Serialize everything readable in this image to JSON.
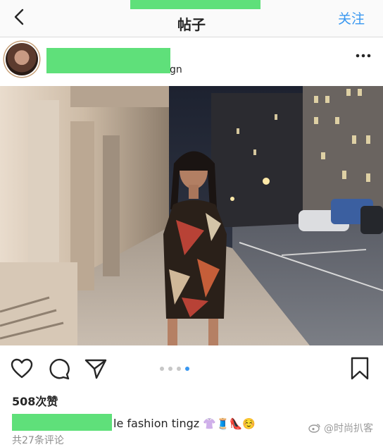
{
  "header": {
    "title": "帖子",
    "follow_label": "关注"
  },
  "post": {
    "location_suffix": "gn",
    "likes": "508次赞",
    "caption_text": "le fashion tingz",
    "caption_emojis": "👚🧵👠☺️",
    "comments_hint": "共27条评论"
  },
  "carousel": {
    "total": 4,
    "active_index": 3
  },
  "watermark": {
    "text": "@时尚扒客"
  },
  "colors": {
    "accent": "#3897f0",
    "redaction": "#5fe07a"
  }
}
